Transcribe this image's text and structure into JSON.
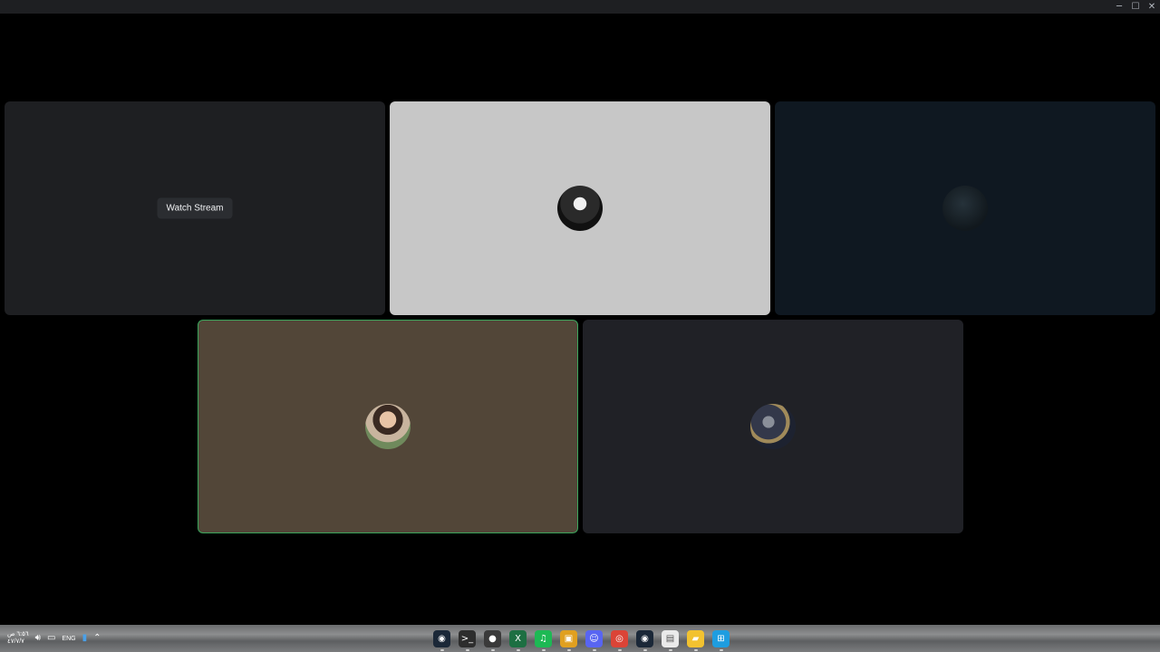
{
  "window": {
    "controls": {
      "minimize": "─",
      "maximize": "☐",
      "close": "✕"
    }
  },
  "tiles": [
    {
      "id": "tile-1",
      "bg": "#1e1f22",
      "watch_label": "Watch Stream"
    },
    {
      "id": "tile-2",
      "bg": "#c7c7c7",
      "avatar": "avatar-bw-group"
    },
    {
      "id": "tile-3",
      "bg": "#0f1821",
      "avatar": "avatar-dark"
    },
    {
      "id": "tile-4",
      "bg": "#524638",
      "avatar": "avatar-person",
      "speaking": true,
      "speaking_color": "#3ba55c"
    },
    {
      "id": "tile-5",
      "bg": "#202126",
      "avatar": "avatar-art"
    }
  ],
  "taskbar": {
    "clock_time": "٦:٥٦ ص",
    "clock_date": "٤٧/٧/٧",
    "tray_icons": [
      "speaker-icon",
      "network-icon"
    ],
    "language": "ENG",
    "mic_icon": "microphone-icon",
    "overflow_icon": "chevron-up-icon",
    "apps": [
      {
        "name": "steam",
        "glyph": "◉",
        "color": "#1b2838"
      },
      {
        "name": "terminal",
        "glyph": ">_",
        "color": "#2d2d2d"
      },
      {
        "name": "obs",
        "glyph": "●",
        "color": "#3a3a3a"
      },
      {
        "name": "excel",
        "glyph": "X",
        "color": "#1d6f42"
      },
      {
        "name": "spotify",
        "glyph": "♫",
        "color": "#1db954"
      },
      {
        "name": "media-app",
        "glyph": "▣",
        "color": "#e0a020"
      },
      {
        "name": "discord",
        "glyph": "☺",
        "color": "#5865f2"
      },
      {
        "name": "chrome",
        "glyph": "◎",
        "color": "#db4437"
      },
      {
        "name": "steam-2",
        "glyph": "◉",
        "color": "#1b2838"
      },
      {
        "name": "notepad",
        "glyph": "▤",
        "color": "#eaeaea"
      },
      {
        "name": "file-explorer",
        "glyph": "▰",
        "color": "#f2c230"
      },
      {
        "name": "start",
        "glyph": "⊞",
        "color": "#1e9de0"
      }
    ]
  }
}
